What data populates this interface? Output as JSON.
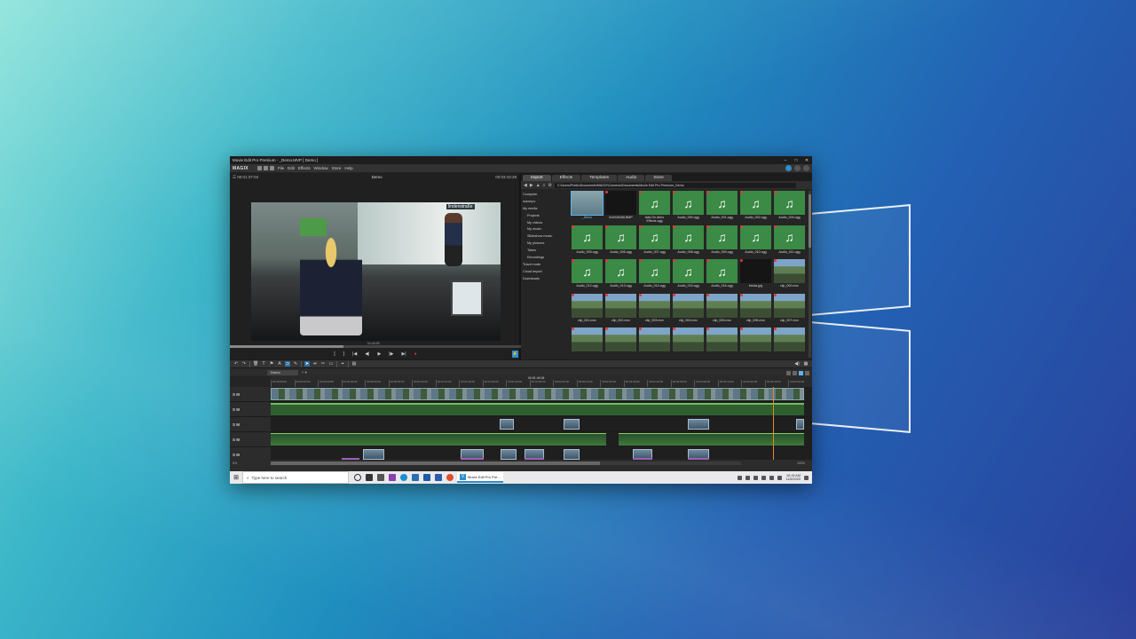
{
  "window": {
    "title": "Movie Edit Pro Premium - _Demo.MVP [ Demo ]",
    "controls": [
      "–",
      "□",
      "✕"
    ]
  },
  "menubar": {
    "logo": "MAGIX",
    "items": [
      "File",
      "Edit",
      "Effects",
      "Window",
      "Store",
      "Help"
    ]
  },
  "player": {
    "time_left": "00:01:37:04",
    "title": "Demo",
    "time_right": "00:03:43:29",
    "scrub_time": "01:44:00",
    "scrub_progress": 0.39,
    "sign_text": "lindenstraße",
    "controls": [
      "[",
      "]",
      "|◀",
      "◀|",
      "▶",
      "|▶",
      "▶|",
      "●"
    ]
  },
  "mediapool": {
    "tabs": [
      "Import",
      "Effects",
      "Templates",
      "Audio",
      "Store"
    ],
    "active_tab": "Import",
    "path": "C:\\Users\\Public\\Documents\\MAGIX\\Common\\Documents\\Movie Edit Pro Premium_Demo",
    "tree": [
      {
        "label": "Computer",
        "indent": false
      },
      {
        "label": "maxmpv",
        "indent": false
      },
      {
        "label": "My media",
        "indent": false
      },
      {
        "label": "Projects",
        "indent": true
      },
      {
        "label": "My videos",
        "indent": true
      },
      {
        "label": "My music",
        "indent": true
      },
      {
        "label": "Slideshow music",
        "indent": true
      },
      {
        "label": "My pictures",
        "indent": true
      },
      {
        "label": "Takes",
        "indent": true
      },
      {
        "label": "Recordings",
        "indent": true
      },
      {
        "label": "Travel route",
        "indent": false
      },
      {
        "label": "Cloud Import",
        "indent": false
      },
      {
        "label": "Downloads",
        "indent": false
      }
    ],
    "files": [
      {
        "name": "_Demo",
        "kind": "folder",
        "selected": true
      },
      {
        "name": "0x0045456.BMP",
        "kind": "dark"
      },
      {
        "name": "Add-On Atmo Effects.ogg",
        "kind": "audio"
      },
      {
        "name": "Audio_000.ogg",
        "kind": "audio"
      },
      {
        "name": "Audio_001.ogg",
        "kind": "audio"
      },
      {
        "name": "Audio_002.ogg",
        "kind": "audio"
      },
      {
        "name": "Audio_004.ogg",
        "kind": "audio"
      },
      {
        "name": "Audio_005.ogg",
        "kind": "audio"
      },
      {
        "name": "Audio_006.ogg",
        "kind": "audio"
      },
      {
        "name": "Audio_007.ogg",
        "kind": "audio"
      },
      {
        "name": "Audio_008.ogg",
        "kind": "audio"
      },
      {
        "name": "Audio_009.ogg",
        "kind": "audio"
      },
      {
        "name": "Audio_010.ogg",
        "kind": "audio"
      },
      {
        "name": "Audio_011.ogg",
        "kind": "audio"
      },
      {
        "name": "Audio_012.ogg",
        "kind": "audio"
      },
      {
        "name": "Audio_013.ogg",
        "kind": "audio"
      },
      {
        "name": "Audio_014.ogg",
        "kind": "audio"
      },
      {
        "name": "Audio_015.ogg",
        "kind": "audio"
      },
      {
        "name": "Audio_016.ogg",
        "kind": "audio"
      },
      {
        "name": "bricks.jpg",
        "kind": "dark"
      },
      {
        "name": "clip_000.mxv",
        "kind": "video"
      },
      {
        "name": "clip_001.mxv",
        "kind": "video"
      },
      {
        "name": "clip_002.mxv",
        "kind": "video"
      },
      {
        "name": "clip_003.mxv",
        "kind": "video"
      },
      {
        "name": "clip_004.mxv",
        "kind": "video"
      },
      {
        "name": "clip_005.mxv",
        "kind": "video"
      },
      {
        "name": "clip_006.mxv",
        "kind": "video"
      },
      {
        "name": "clip_007.mxv",
        "kind": "video"
      },
      {
        "name": "",
        "kind": "video"
      },
      {
        "name": "",
        "kind": "video"
      },
      {
        "name": "",
        "kind": "video"
      },
      {
        "name": "",
        "kind": "video"
      },
      {
        "name": "",
        "kind": "video"
      },
      {
        "name": "",
        "kind": "video"
      },
      {
        "name": "",
        "kind": "video"
      }
    ]
  },
  "timeline": {
    "tab_label": "Demo",
    "position": "00:01:44:04",
    "ruler": [
      "00:00:00:00",
      "00:00:10:00",
      "00:00:20:00",
      "00:00:30:00",
      "00:00:40:00",
      "00:00:50:00",
      "00:01:00:00",
      "00:01:10:00",
      "00:01:20:00",
      "00:01:30:00",
      "00:01:40:00",
      "00:01:50:00",
      "00:02:00:00",
      "00:02:10:00",
      "00:02:20:00",
      "00:02:30:00",
      "00:02:40:00",
      "00:02:50:00",
      "00:03:00:00",
      "00:03:10:00",
      "00:03:20:00",
      "00:03:30:00",
      "00:03:40:00"
    ],
    "track_label": "S M",
    "footer_left": "0%",
    "zoom": "100%"
  },
  "taskbar": {
    "search_placeholder": "Type here to search",
    "active_app": "Movie Edit Pro Pre...",
    "time": "10:15 AM",
    "date": "11/5/2020"
  }
}
